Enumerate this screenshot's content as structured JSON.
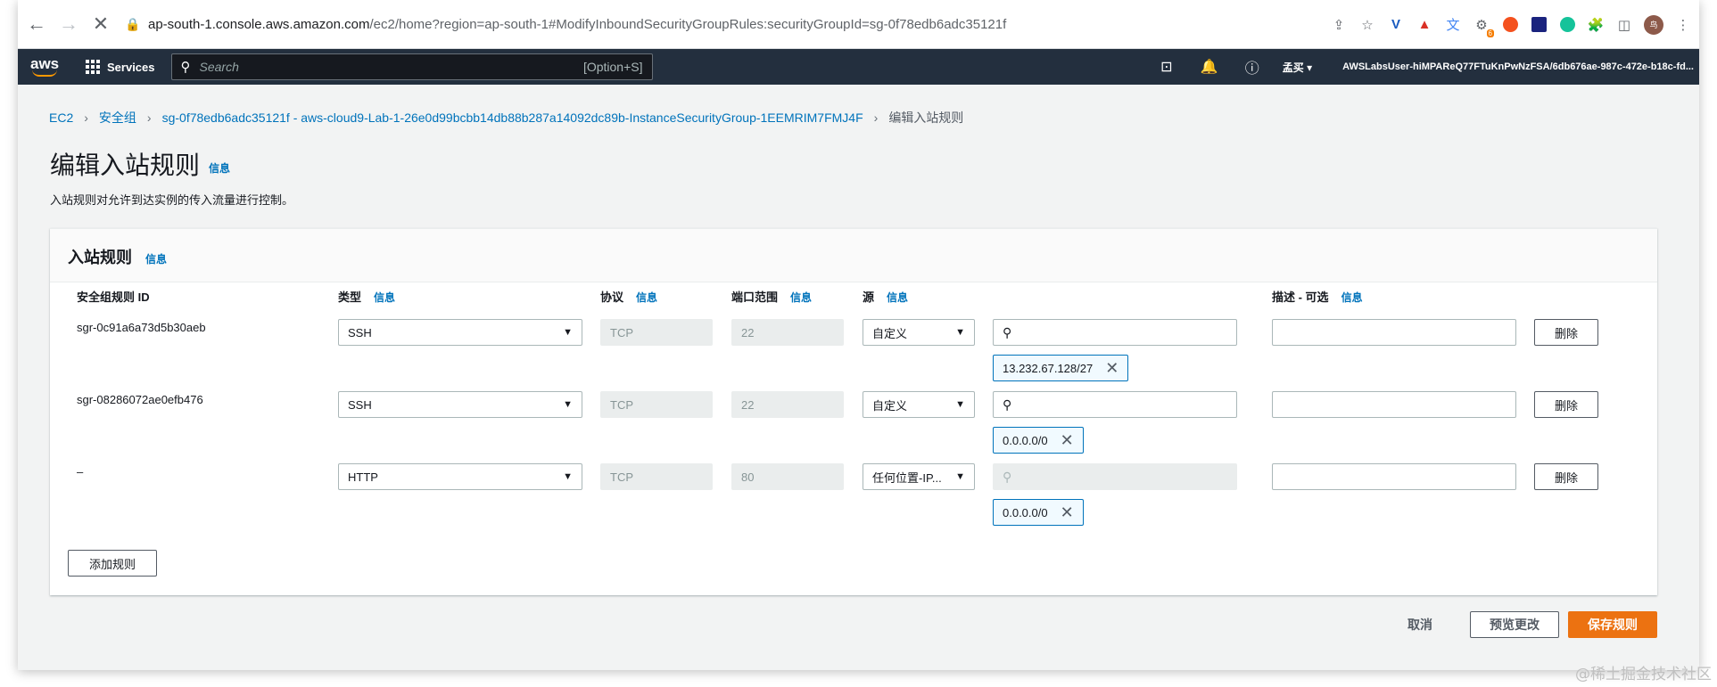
{
  "browser": {
    "url_host": "ap-south-1.console.aws.amazon.com",
    "url_path": "/ec2/home?region=ap-south-1#ModifyInboundSecurityGroupRules:securityGroupId=sg-0f78edb6adc35121f",
    "avatar_text": "鸟",
    "extension_badge": "6"
  },
  "awsnav": {
    "logo": "aws",
    "services_label": "Services",
    "search_placeholder": "Search",
    "search_shortcut": "[Option+S]",
    "region": "孟买 ▾",
    "user": "AWSLabsUser-hiMPAReQ77FTuKnPwNzFSA/6db676ae-987c-472e-b18c-fd..."
  },
  "breadcrumb": {
    "items": [
      "EC2",
      "安全组",
      "sg-0f78edb6adc35121f - aws-cloud9-Lab-1-26e0d99bcbb14db88b287a14092dc89b-InstanceSecurityGroup-1EEMRIM7FMJ4F"
    ],
    "current": "编辑入站规则"
  },
  "page": {
    "title": "编辑入站规则",
    "info": "信息",
    "description": "入站规则对允许到达实例的传入流量进行控制。"
  },
  "panel": {
    "title": "入站规则",
    "info": "信息",
    "columns": {
      "id": "安全组规则 ID",
      "type": "类型",
      "protocol": "协议",
      "port": "端口范围",
      "source": "源",
      "desc": "描述 - 可选",
      "info": "信息"
    },
    "rules": [
      {
        "id": "sgr-0c91a6a73d5b30aeb",
        "type": "SSH",
        "protocol": "TCP",
        "port": "22",
        "source": "自定义",
        "cidr": "13.232.67.128/27",
        "delete": "删除"
      },
      {
        "id": "sgr-08286072ae0efb476",
        "type": "SSH",
        "protocol": "TCP",
        "port": "22",
        "source": "自定义",
        "cidr": "0.0.0.0/0",
        "delete": "删除"
      },
      {
        "id": "–",
        "type": "HTTP",
        "protocol": "TCP",
        "port": "80",
        "source": "任何位置-IP...",
        "cidr": "0.0.0.0/0",
        "delete": "删除"
      }
    ],
    "add_rule": "添加规则"
  },
  "actions": {
    "cancel": "取消",
    "preview": "预览更改",
    "save": "保存规则"
  },
  "watermark": "@稀土掘金技术社区"
}
